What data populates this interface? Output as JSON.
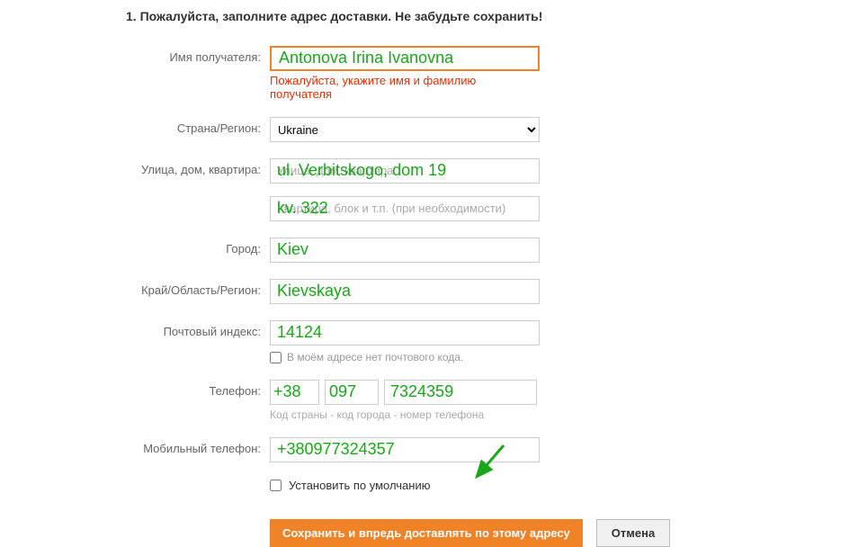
{
  "heading": "1. Пожалуйста, заполните адрес доставки. Не забудьте сохранить!",
  "labels": {
    "recipient": "Имя получателя:",
    "country": "Страна/Регион:",
    "street": "Улица, дом, квартира:",
    "city": "Город:",
    "region": "Край/Область/Регион:",
    "postal": "Почтовый индекс:",
    "phone": "Телефон:",
    "mobile": "Мобильный телефон:"
  },
  "errors": {
    "recipient": "Пожалуйста, укажите имя и фамилию получателя"
  },
  "placeholders": {
    "street1": "Улица, дом, квартира",
    "street2": "Квартира, блок и т.п. (при необходимости)"
  },
  "values": {
    "recipient_overlay": "Antonova Irina Ivanovna",
    "country": "Ukraine",
    "street1_overlay": "ul. Verbitskogo, dom 19",
    "street2_overlay": "kv. 322",
    "city_overlay": "Kiev",
    "region_overlay": "Kievskaya",
    "postal_overlay": "14124",
    "phone_cc": "+38",
    "phone_area": "097",
    "phone_num": "7324359",
    "mobile_overlay": "+380977324357"
  },
  "helpers": {
    "postal_none": "В моём адресе нет почтового кода.",
    "phone": "Код страны - код города - номер телефона"
  },
  "checkbox": {
    "default": "Установить по умолчанию"
  },
  "buttons": {
    "save": "Сохранить и впредь доставлять по этому адресу",
    "cancel": "Отмена"
  }
}
